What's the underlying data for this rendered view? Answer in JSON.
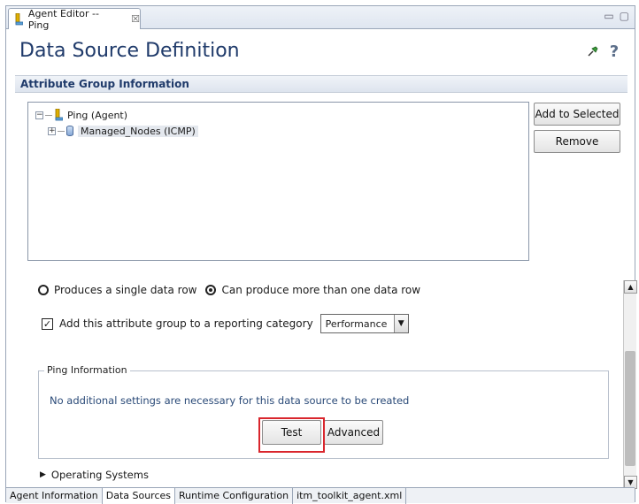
{
  "window": {
    "tab_title": "Agent Editor -- Ping",
    "close_glyph": "☒"
  },
  "header": {
    "title": "Data Source Definition",
    "help_glyph": "?"
  },
  "attribute_group": {
    "section_title": "Attribute Group Information",
    "tree": [
      {
        "label": "Ping (Agent)",
        "expander": "−"
      },
      {
        "label": "Managed_Nodes (ICMP)",
        "expander": "+"
      }
    ],
    "buttons": {
      "add": "Add to Selected",
      "remove": "Remove"
    }
  },
  "options": {
    "radio_single": "Produces a single data row",
    "radio_multiple": "Can produce more than one data row",
    "selected_radio": "multiple",
    "reporting_checkbox_label": "Add this attribute group to a reporting category",
    "reporting_checked": true,
    "reporting_category": "Performance"
  },
  "ping_info": {
    "legend": "Ping Information",
    "description": "No additional settings are necessary for this data source to be created",
    "test_label": "Test",
    "advanced_label": "Advanced"
  },
  "operating_systems": {
    "label": "Operating Systems"
  },
  "bottom_tabs": [
    {
      "label": "Agent Information",
      "active": false
    },
    {
      "label": "Data Sources",
      "active": true
    },
    {
      "label": "Runtime Configuration",
      "active": false
    },
    {
      "label": "itm_toolkit_agent.xml",
      "active": false
    }
  ],
  "colors": {
    "title": "#1f3a6a",
    "highlight": "#d9262d"
  }
}
